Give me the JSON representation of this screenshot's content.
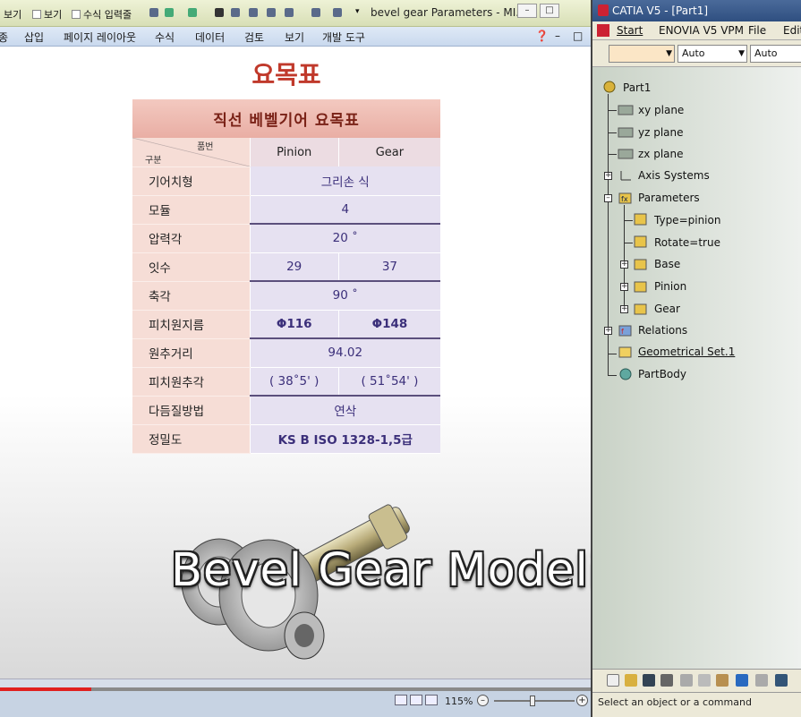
{
  "excel": {
    "quick_access": {
      "view1": "보기",
      "view2": "보기",
      "formula_bar_label": "수식 입력줄"
    },
    "window_title": "bevel gear Parameters - MI...",
    "menu": [
      "종",
      "삽입",
      "페이지 레이아웃",
      "수식",
      "데이터",
      "검토",
      "보기",
      "개발 도구"
    ],
    "slide_title": "요목표",
    "table": {
      "title": "직선 베벨기어 요목표",
      "corner_top": "품번",
      "corner_bottom": "구분",
      "col1": "Pinion",
      "col2": "Gear",
      "rows": [
        {
          "label": "기어치형",
          "value": "그리손 식"
        },
        {
          "label": "모듈",
          "value": "4"
        },
        {
          "label": "압력각",
          "value": "20 ˚"
        },
        {
          "label": "잇수",
          "pinion": "29",
          "gear": "37"
        },
        {
          "label": "축각",
          "value": "90 ˚"
        },
        {
          "label": "피치원지름",
          "pinion": "Φ116",
          "gear": "Φ148"
        },
        {
          "label": "원추거리",
          "value": "94.02"
        },
        {
          "label": "피치원추각",
          "pinion": "( 38˚5' )",
          "gear": "( 51˚54' )"
        },
        {
          "label": "다듬질방법",
          "value": "연삭"
        },
        {
          "label": "정밀도",
          "value": "KS B ISO 1328-1,5급"
        }
      ]
    },
    "overlay_title": "Bevel Gear Modeling",
    "zoom": "115%",
    "video_progress": 0.155
  },
  "catia": {
    "title": "CATIA V5 - [Part1]",
    "menu": {
      "start": "Start",
      "enovia": "ENOVIA V5 VPM",
      "file": "File",
      "edit": "Edit"
    },
    "toolbar": {
      "combo1": "",
      "combo2": "Auto",
      "combo3": "Auto"
    },
    "tree": {
      "root": "Part1",
      "planes": [
        "xy plane",
        "yz plane",
        "zx plane"
      ],
      "axis_systems": "Axis Systems",
      "parameters": "Parameters",
      "params": [
        "Type=pinion",
        "Rotate=true"
      ],
      "param_sets": [
        "Base",
        "Pinion",
        "Gear"
      ],
      "relations": "Relations",
      "geometrical_set": "Geometrical Set.1",
      "part_body": "PartBody"
    },
    "status": "Select an object or a command"
  },
  "colors": {
    "title_red": "#c0392b",
    "header_pink": "#e9aea4",
    "label_bg": "#f6ddd6",
    "value_bg": "#e6e1f1",
    "value_text": "#3b2f7a",
    "progress_red": "#e02020"
  }
}
